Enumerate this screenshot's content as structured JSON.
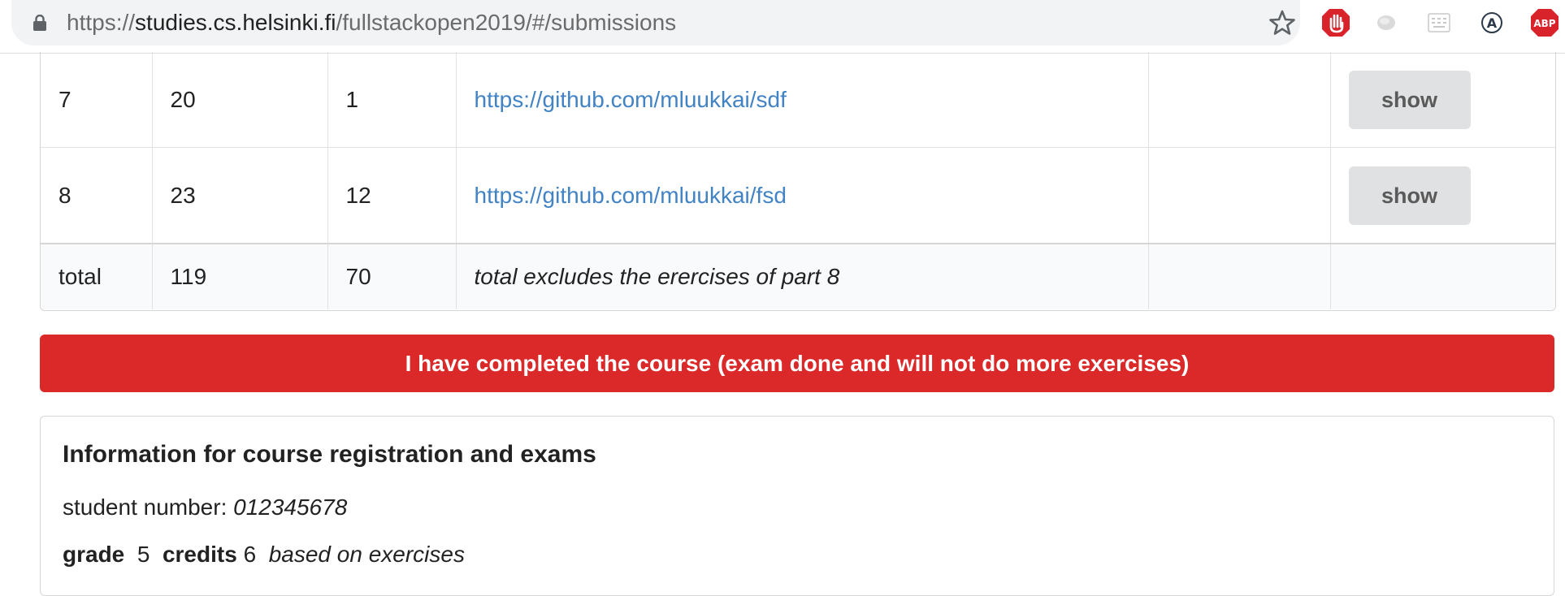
{
  "browser": {
    "url_scheme": "https://",
    "url_host": "studies.cs.helsinki.fi",
    "url_path": "/fullstackopen2019/#/submissions",
    "extensions": [
      "stop-hand-icon",
      "puzzle-icon",
      "keyboard-icon",
      "translate-icon",
      "adblock-plus-icon"
    ],
    "ext_label_abp": "ABP",
    "ext_label_a": "A"
  },
  "table": {
    "rows": [
      {
        "part": "7",
        "exercises": "20",
        "hours": "1",
        "github": "https://github.com/mluukkai/sdf",
        "comment": "",
        "action": "show"
      },
      {
        "part": "8",
        "exercises": "23",
        "hours": "12",
        "github": "https://github.com/mluukkai/fsd",
        "comment": "",
        "action": "show"
      }
    ],
    "total": {
      "label": "total",
      "exercises": "119",
      "hours": "70",
      "note": "total excludes the erercises of part 8"
    }
  },
  "complete_button": "I have completed the course (exam done and will not do more exercises)",
  "info": {
    "heading": "Information for course registration and exams",
    "student_number_label": "student number:",
    "student_number": "012345678",
    "grade_label": "grade",
    "grade": "5",
    "credits_label": "credits",
    "credits": "6",
    "basis": "based on exercises"
  },
  "colors": {
    "primary_red": "#db2828",
    "link_blue": "#4183c4",
    "button_grey": "#e0e1e2"
  }
}
